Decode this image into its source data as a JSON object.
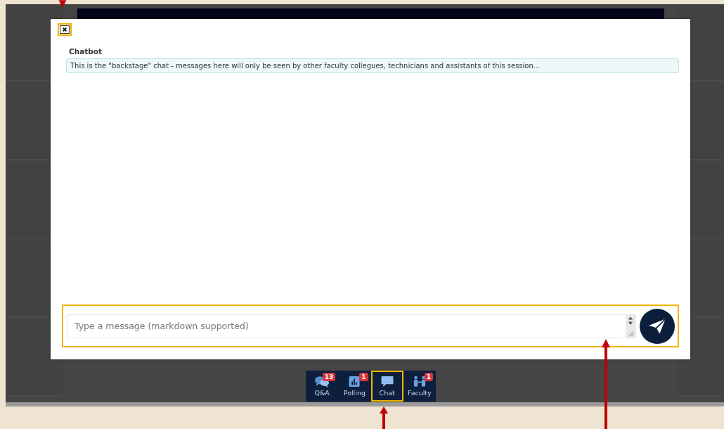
{
  "dialog": {
    "close": {
      "highlighted": true
    },
    "sender": "Chatbot",
    "message": "This is the \"backstage\" chat - messages here will only be seen by other faculty collegues, technicians and assistants of this session...",
    "composer": {
      "placeholder": "Type a message (markdown supported)",
      "highlighted": true
    }
  },
  "toolbar": [
    {
      "kind": "qa",
      "label": "Q&A",
      "badge": "13",
      "highlighted": false
    },
    {
      "kind": "polling",
      "label": "Polling",
      "badge": "1",
      "highlighted": false
    },
    {
      "kind": "chat",
      "label": "Chat",
      "highlighted": true
    },
    {
      "kind": "faculty",
      "label": "Faculty",
      "badge": "1",
      "highlighted": false
    }
  ]
}
